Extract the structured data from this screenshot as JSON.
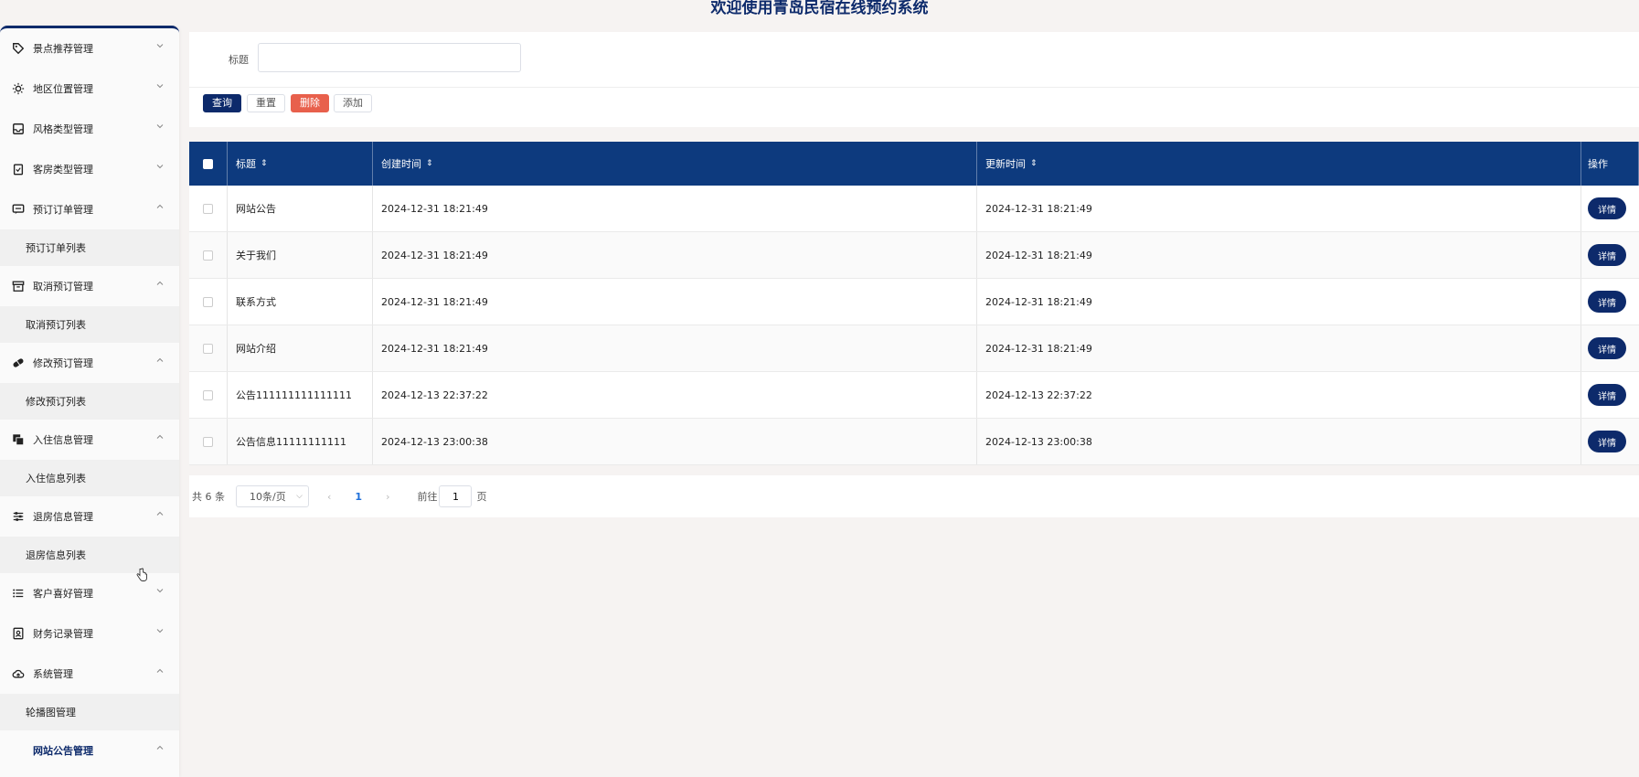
{
  "app": {
    "title": "欢迎使用青岛民宿在线预约系统"
  },
  "sidebar": {
    "items": [
      {
        "label": "景点推荐管理",
        "icon": "tag-icon",
        "expanded": false
      },
      {
        "label": "地区位置管理",
        "icon": "sun-icon",
        "expanded": false
      },
      {
        "label": "风格类型管理",
        "icon": "inbox-icon",
        "expanded": false
      },
      {
        "label": "客房类型管理",
        "icon": "clipboard-icon",
        "expanded": false
      },
      {
        "label": "预订订单管理",
        "icon": "message-icon",
        "expanded": true,
        "sub": "预订订单列表"
      },
      {
        "label": "取消预订管理",
        "icon": "archive-icon",
        "expanded": true,
        "sub": "取消预订列表"
      },
      {
        "label": "修改预订管理",
        "icon": "pill-icon",
        "expanded": true,
        "sub": "修改预订列表"
      },
      {
        "label": "入住信息管理",
        "icon": "copy-icon",
        "expanded": true,
        "sub": "入住信息列表"
      },
      {
        "label": "退房信息管理",
        "icon": "sliders-icon",
        "expanded": true,
        "sub": "退房信息列表"
      },
      {
        "label": "客户喜好管理",
        "icon": "list-icon",
        "expanded": false
      },
      {
        "label": "财务记录管理",
        "icon": "contact-icon",
        "expanded": false
      },
      {
        "label": "系统管理",
        "icon": "cloud-icon",
        "expanded": true,
        "sub": "轮播图管理"
      },
      {
        "label": "网站公告管理",
        "expanded": true
      }
    ]
  },
  "search": {
    "title_label": "标题",
    "title_value": ""
  },
  "buttons": {
    "query": "查询",
    "reset": "重置",
    "delete": "删除",
    "add": "添加"
  },
  "table": {
    "headers": {
      "title": "标题",
      "created": "创建时间",
      "updated": "更新时间",
      "op": "操作"
    },
    "rows": [
      {
        "title": "网站公告",
        "created": "2024-12-31 18:21:49",
        "updated": "2024-12-31 18:21:49",
        "action": "详情"
      },
      {
        "title": "关于我们",
        "created": "2024-12-31 18:21:49",
        "updated": "2024-12-31 18:21:49",
        "action": "详情"
      },
      {
        "title": "联系方式",
        "created": "2024-12-31 18:21:49",
        "updated": "2024-12-31 18:21:49",
        "action": "详情"
      },
      {
        "title": "网站介绍",
        "created": "2024-12-31 18:21:49",
        "updated": "2024-12-31 18:21:49",
        "action": "详情"
      },
      {
        "title": "公告111111111111111",
        "created": "2024-12-13 22:37:22",
        "updated": "2024-12-13 22:37:22",
        "action": "详情"
      },
      {
        "title": "公告信息11111111111",
        "created": "2024-12-13 23:00:38",
        "updated": "2024-12-13 23:00:38",
        "action": "详情"
      }
    ]
  },
  "pager": {
    "total": "共 6 条",
    "size": "10条/页",
    "current": "1",
    "goto_label": "前往",
    "goto_value": "1",
    "unit": "页"
  }
}
